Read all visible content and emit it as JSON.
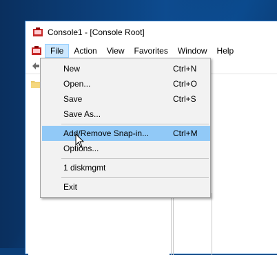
{
  "window": {
    "title": "Console1 - [Console Root]"
  },
  "menubar": {
    "items": [
      "File",
      "Action",
      "View",
      "Favorites",
      "Window",
      "Help"
    ],
    "active": "File"
  },
  "file_menu": {
    "items": [
      {
        "label": "New",
        "shortcut": "Ctrl+N"
      },
      {
        "label": "Open...",
        "shortcut": "Ctrl+O"
      },
      {
        "label": "Save",
        "shortcut": "Ctrl+S"
      },
      {
        "label": "Save As...",
        "shortcut": ""
      },
      {
        "label": "Add/Remove Snap-in...",
        "shortcut": "Ctrl+M",
        "highlighted": true
      },
      {
        "label": "Options...",
        "shortcut": ""
      },
      {
        "label": "1 diskmgmt",
        "shortcut": ""
      },
      {
        "label": "Exit",
        "shortcut": ""
      }
    ]
  },
  "colors": {
    "highlight": "#91c9f7",
    "menu_bg": "#f2f2f2",
    "active_menu": "#cce8ff",
    "window_border": "#1f74c8"
  },
  "icons": [
    "mmc-app-icon",
    "mmc-doc-icon",
    "back-arrow-icon",
    "folder-icon",
    "mouse-pointer-icon"
  ]
}
